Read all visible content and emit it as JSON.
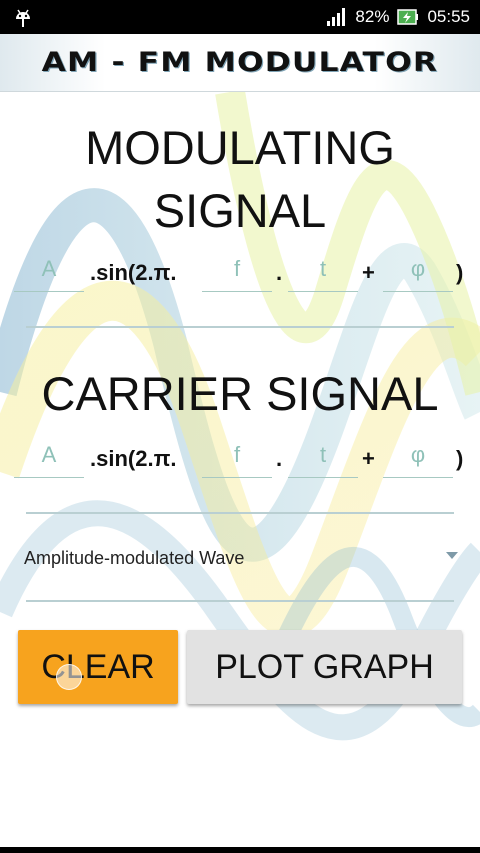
{
  "status_bar": {
    "battery_percent": "82%",
    "time": "05:55",
    "icons": [
      "android-debug-icon",
      "signal-icon",
      "battery-charging-icon"
    ]
  },
  "app": {
    "title": "AM - FM MODULATOR"
  },
  "modulating": {
    "heading_line1": "MODULATING",
    "heading_line2": "SIGNAL",
    "amplitude_placeholder": "A",
    "sin_label": ".sin(2.π.",
    "frequency_placeholder": "f",
    "dot_label": ".",
    "time_placeholder": "t",
    "plus_label": "+",
    "phase_placeholder": "φ",
    "close_paren": ")"
  },
  "carrier": {
    "heading": "CARRIER SIGNAL",
    "amplitude_placeholder": "A",
    "sin_label": ".sin(2.π.",
    "frequency_placeholder": "f",
    "dot_label": ".",
    "time_placeholder": "t",
    "plus_label": "+",
    "phase_placeholder": "φ",
    "close_paren": ")"
  },
  "wave_type": {
    "selected": "Amplitude-modulated Wave"
  },
  "buttons": {
    "clear": "CLEAR",
    "plot": "PLOT GRAPH"
  },
  "colors": {
    "accent_orange": "#f7a31e",
    "placeholder_teal": "#8fc1b8",
    "status_bar": "#000000"
  }
}
